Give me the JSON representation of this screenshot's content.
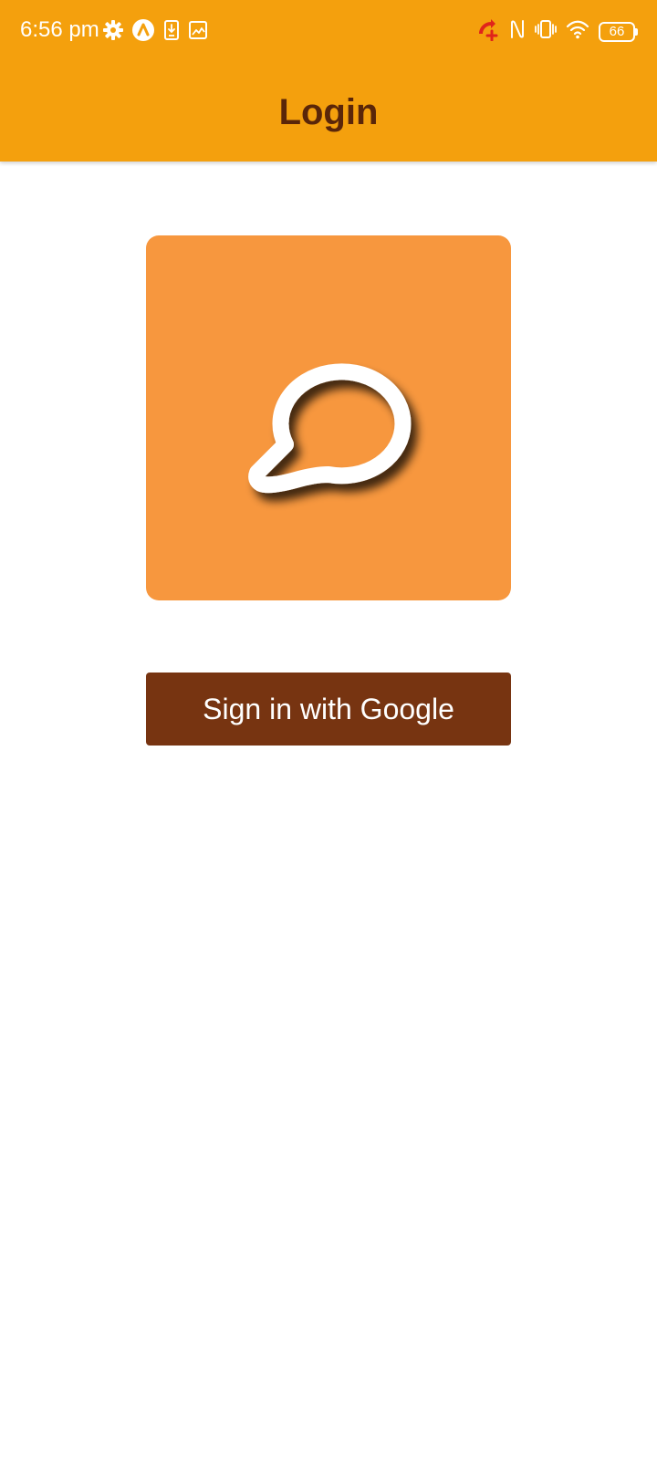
{
  "status_bar": {
    "time": "6:56 pm",
    "battery_level": "66",
    "left_icons": [
      "gear-icon",
      "navigation-a-icon",
      "download-icon",
      "gallery-icon"
    ],
    "right_icons": [
      "call-forward-icon",
      "nfc-icon",
      "vibrate-icon",
      "wifi-icon",
      "battery-icon"
    ],
    "call_icon_color": "#e0241b"
  },
  "app_bar": {
    "title": "Login",
    "background": "#f4a00d",
    "title_color": "#5a2609"
  },
  "logo": {
    "icon": "chat-bubble-icon",
    "background": "#f7973e"
  },
  "sign_in_button": {
    "label": "Sign in with Google",
    "background": "#773411",
    "text_color": "#ffffff"
  }
}
